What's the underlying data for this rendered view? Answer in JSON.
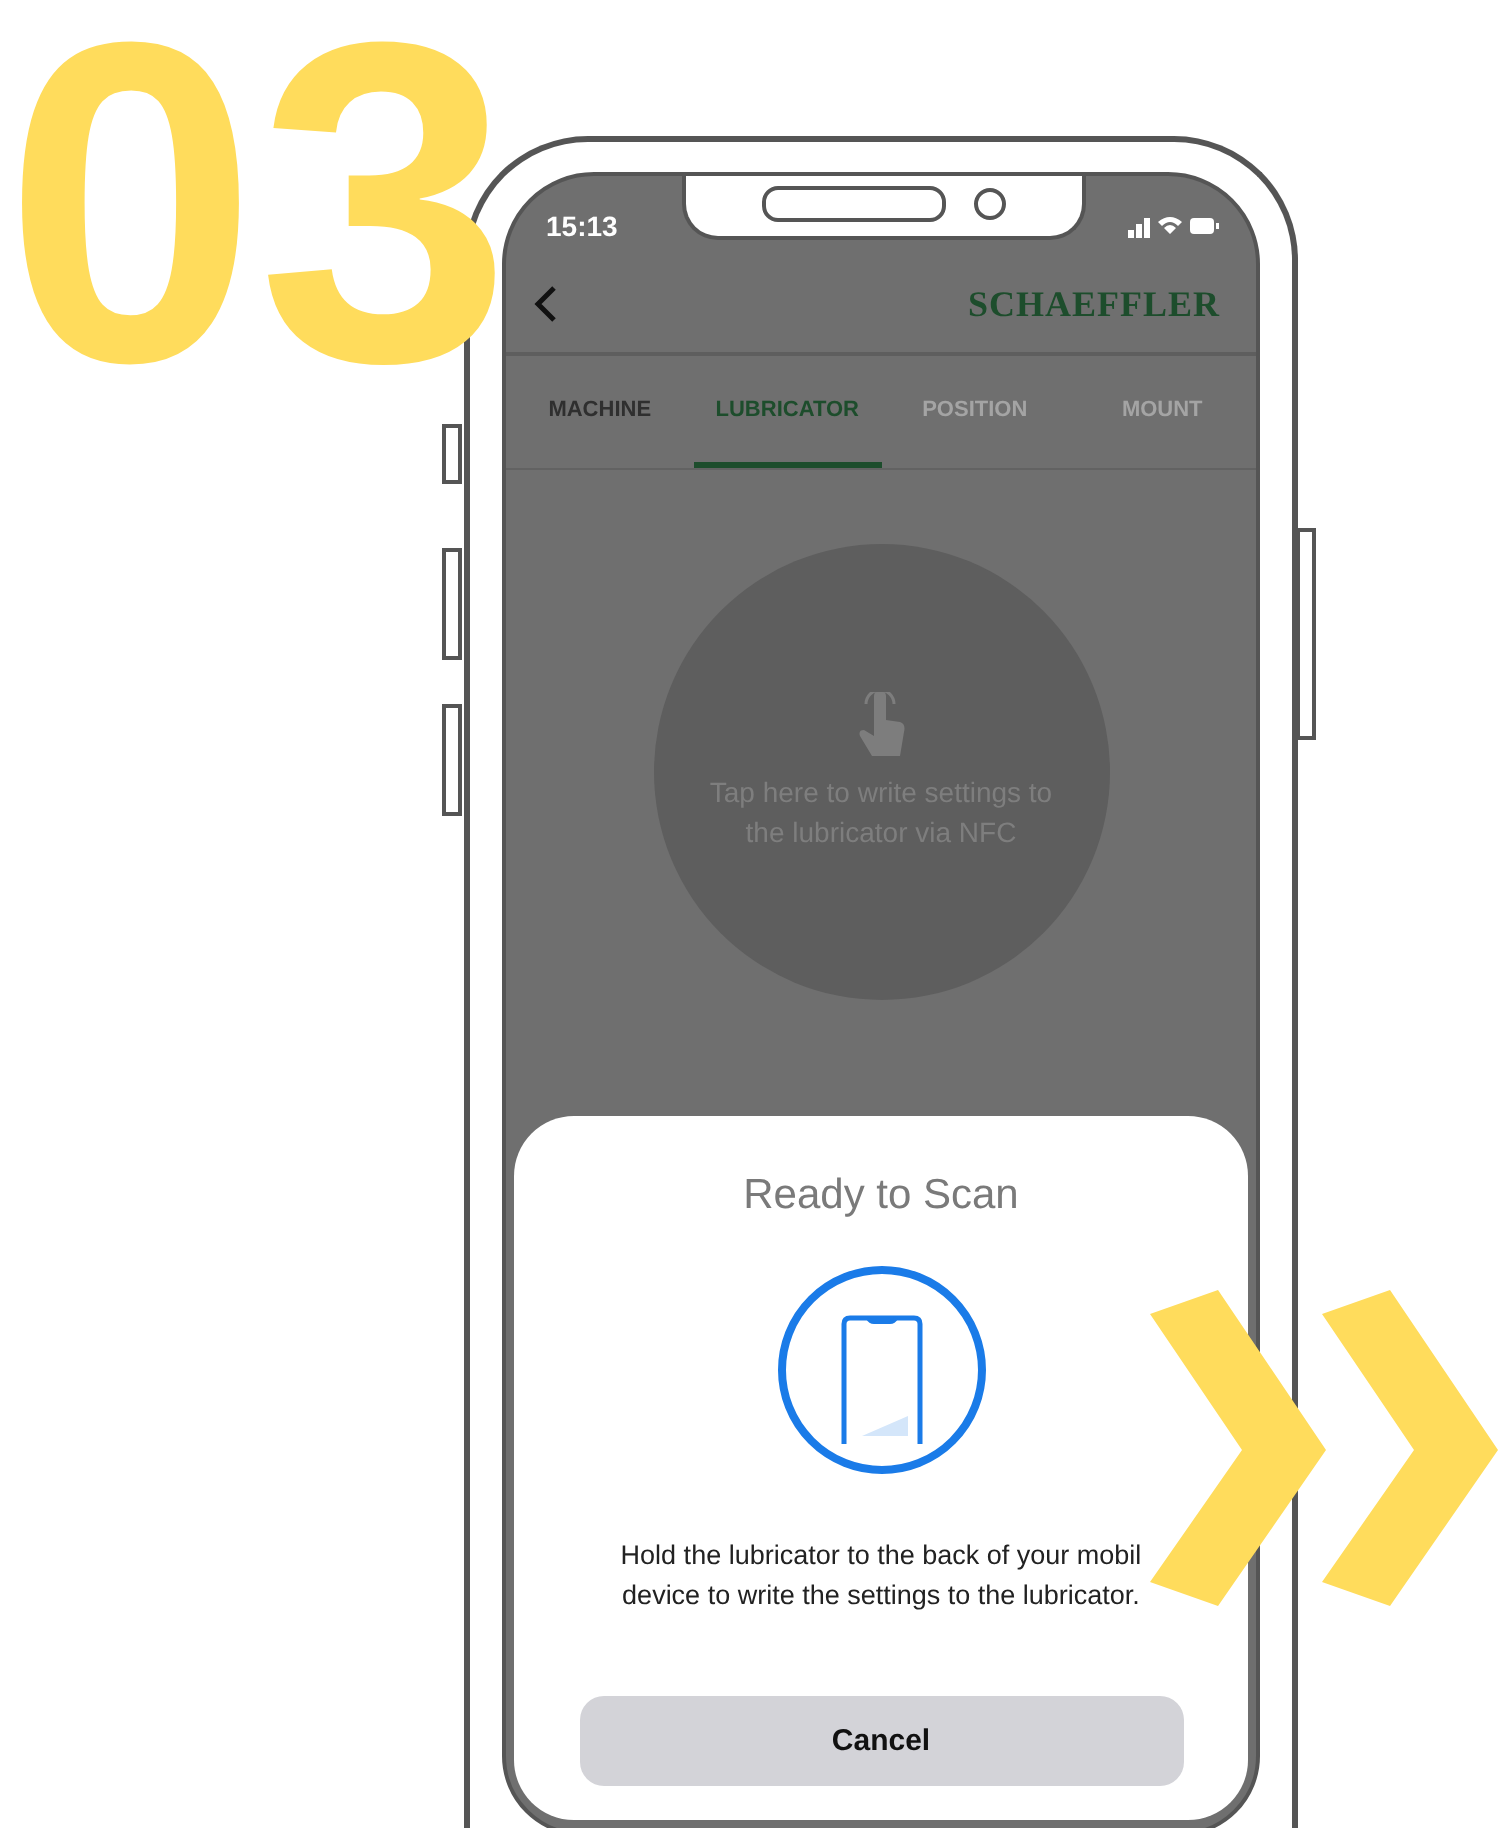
{
  "step_number": "03",
  "status_bar": {
    "time": "15:13"
  },
  "header": {
    "brand": "SCHAEFFLER"
  },
  "tabs": [
    {
      "label": "MACHINE",
      "selected": false,
      "disabled": false
    },
    {
      "label": "LUBRICATOR",
      "selected": true,
      "disabled": false
    },
    {
      "label": "POSITION",
      "selected": false,
      "disabled": true
    },
    {
      "label": "MOUNT",
      "selected": false,
      "disabled": true
    }
  ],
  "nfc_button": {
    "label": "Tap here to write settings to the lubricator via NFC"
  },
  "scan_sheet": {
    "title": "Ready to Scan",
    "message_lines": [
      "Hold the lubricator to the back of your mobil",
      "device to write the settings to the lubricator."
    ],
    "button": "Cancel"
  }
}
